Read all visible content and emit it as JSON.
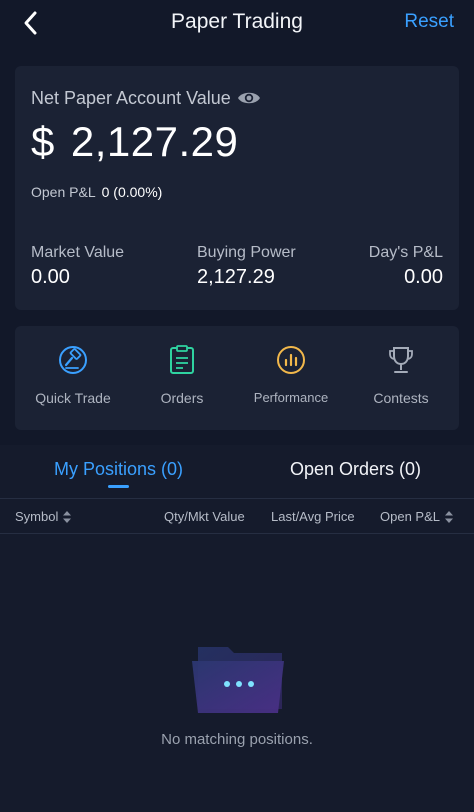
{
  "header": {
    "title": "Paper Trading",
    "reset_label": "Reset"
  },
  "account": {
    "net_label": "Net Paper Account Value",
    "currency_symbol": "$",
    "net_value": "2,127.29",
    "open_pl_label": "Open P&L",
    "open_pl_value": "0 (0.00%)",
    "market_value_label": "Market Value",
    "market_value": "0.00",
    "buying_power_label": "Buying Power",
    "buying_power": "2,127.29",
    "days_pl_label": "Day's P&L",
    "days_pl": "0.00"
  },
  "actions": [
    {
      "label": "Quick Trade",
      "icon": "hammer-icon",
      "color": "#3aa0ff"
    },
    {
      "label": "Orders",
      "icon": "orders-icon",
      "color": "#2fd3a0"
    },
    {
      "label": "Performance",
      "icon": "performance-icon",
      "color": "#f2b84b"
    },
    {
      "label": "Contests",
      "icon": "trophy-icon",
      "color": "#a4abb8"
    }
  ],
  "tabs": {
    "positions_label": "My Positions (0)",
    "orders_label": "Open Orders (0)"
  },
  "columns": {
    "symbol": "Symbol",
    "qty": "Qty/Mkt Value",
    "last": "Last/Avg Price",
    "open_pl": "Open P&L"
  },
  "empty": {
    "message": "No matching positions."
  },
  "colors": {
    "accent": "#3aa0ff",
    "background": "#121829",
    "card": "#1b2234"
  }
}
